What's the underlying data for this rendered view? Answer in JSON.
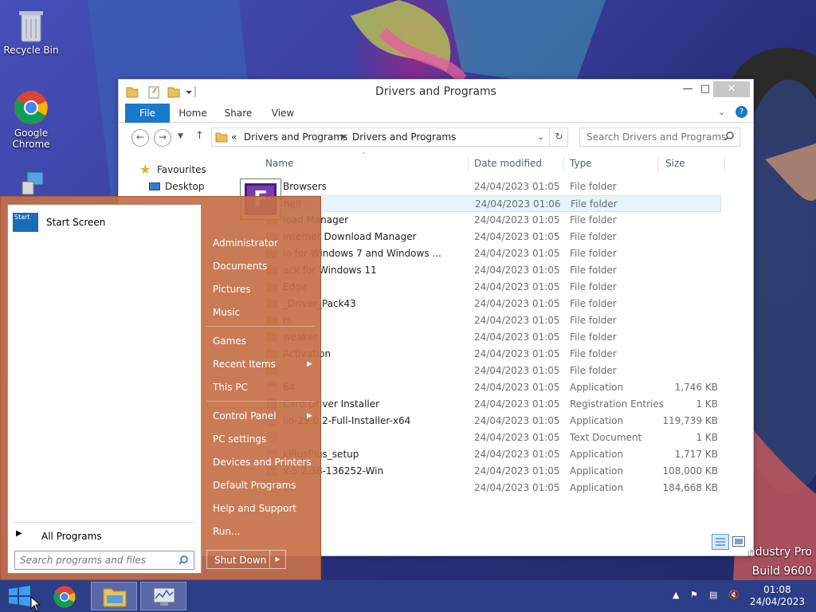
{
  "desktop": {
    "icons": [
      {
        "label": "Recycle Bin"
      },
      {
        "label": "Google Chrome"
      }
    ],
    "watermark": {
      "line1": "ndustry Pro",
      "line2": "Build 9600"
    }
  },
  "explorer": {
    "title": "Drivers and Programs",
    "ribbon_tabs": [
      "File",
      "Home",
      "Share",
      "View"
    ],
    "address": {
      "prefix": "«",
      "crumb1": "Drivers and Programs",
      "crumb2": "Drivers and Programs"
    },
    "search_placeholder": "Search Drivers and Programs",
    "nav": {
      "favourites": "Favourites",
      "desktop": "Desktop"
    },
    "columns": {
      "name": "Name",
      "date": "Date modified",
      "type": "Type",
      "size": "Size"
    },
    "files": [
      {
        "name": "Browsers",
        "date": "24/04/2023 01:05",
        "type": "File folder",
        "size": "",
        "kind": "folder"
      },
      {
        "name": "hell",
        "date": "24/04/2023 01:06",
        "type": "File folder",
        "size": "",
        "kind": "folder"
      },
      {
        "name": "load Manager",
        "date": "24/04/2023 01:05",
        "type": "File folder",
        "size": "",
        "kind": "folder"
      },
      {
        "name": "Internet Download Manager",
        "date": "24/04/2023 01:05",
        "type": "File folder",
        "size": "",
        "kind": "folder"
      },
      {
        "name": "io for Windows 7 and Windows ...",
        "date": "24/04/2023 01:05",
        "type": "File folder",
        "size": "",
        "kind": "folder"
      },
      {
        "name": "ack for Windows 11",
        "date": "24/04/2023 01:05",
        "type": "File folder",
        "size": "",
        "kind": "folder"
      },
      {
        "name": "Edge",
        "date": "24/04/2023 01:05",
        "type": "File folder",
        "size": "",
        "kind": "folder"
      },
      {
        "name": "_Driver_Pack43",
        "date": "24/04/2023 01:05",
        "type": "File folder",
        "size": "",
        "kind": "folder"
      },
      {
        "name": "rs",
        "date": "24/04/2023 01:05",
        "type": "File folder",
        "size": "",
        "kind": "folder"
      },
      {
        "name": "weaker",
        "date": "24/04/2023 01:05",
        "type": "File folder",
        "size": "",
        "kind": "folder"
      },
      {
        "name": "Activation",
        "date": "24/04/2023 01:05",
        "type": "File folder",
        "size": "",
        "kind": "folder"
      },
      {
        "name": "",
        "date": "24/04/2023 01:05",
        "type": "File folder",
        "size": "",
        "kind": "folder"
      },
      {
        "name": "64",
        "date": "24/04/2023 01:05",
        "type": "Application",
        "size": "1,746 KB",
        "kind": "app"
      },
      {
        "name": "Card Driver Installer",
        "date": "24/04/2023 01:05",
        "type": "Registration Entries",
        "size": "1 KB",
        "kind": "reg"
      },
      {
        "name": "lio-29.0.2-Full-Installer-x64",
        "date": "24/04/2023 01:05",
        "type": "Application",
        "size": "119,739 KB",
        "kind": "app"
      },
      {
        "name": "",
        "date": "24/04/2023 01:05",
        "type": "Text Document",
        "size": "1 KB",
        "kind": "txt"
      },
      {
        "name": "kPlusPlus_setup",
        "date": "24/04/2023 01:05",
        "type": "Application",
        "size": "1,717 KB",
        "kind": "app"
      },
      {
        "name": "x-5.2.38-136252-Win",
        "date": "24/04/2023 01:05",
        "type": "Application",
        "size": "108,000 KB",
        "kind": "app"
      },
      {
        "name": "15",
        "date": "24/04/2023 01:05",
        "type": "Application",
        "size": "184,668 KB",
        "kind": "app"
      }
    ]
  },
  "startmenu": {
    "start_screen": "Start Screen",
    "start_tile_text": "Start",
    "all_programs": "All Programs",
    "search_placeholder": "Search programs and files",
    "right": {
      "administrator": "Administrator",
      "documents": "Documents",
      "pictures": "Pictures",
      "music": "Music",
      "games": "Games",
      "recent_items": "Recent Items",
      "this_pc": "This PC",
      "control_panel": "Control Panel",
      "pc_settings": "PC settings",
      "devices_printers": "Devices and Printers",
      "default_programs": "Default Programs",
      "help_support": "Help and Support",
      "run": "Run...",
      "shut_down": "Shut Down"
    },
    "tile_letter": "F"
  },
  "taskbar": {
    "time": "01:08",
    "date": "24/04/2023"
  },
  "colors": {
    "accent": "#1979ca",
    "startmenu": "#c47048",
    "taskbar": "#2c3e86"
  }
}
